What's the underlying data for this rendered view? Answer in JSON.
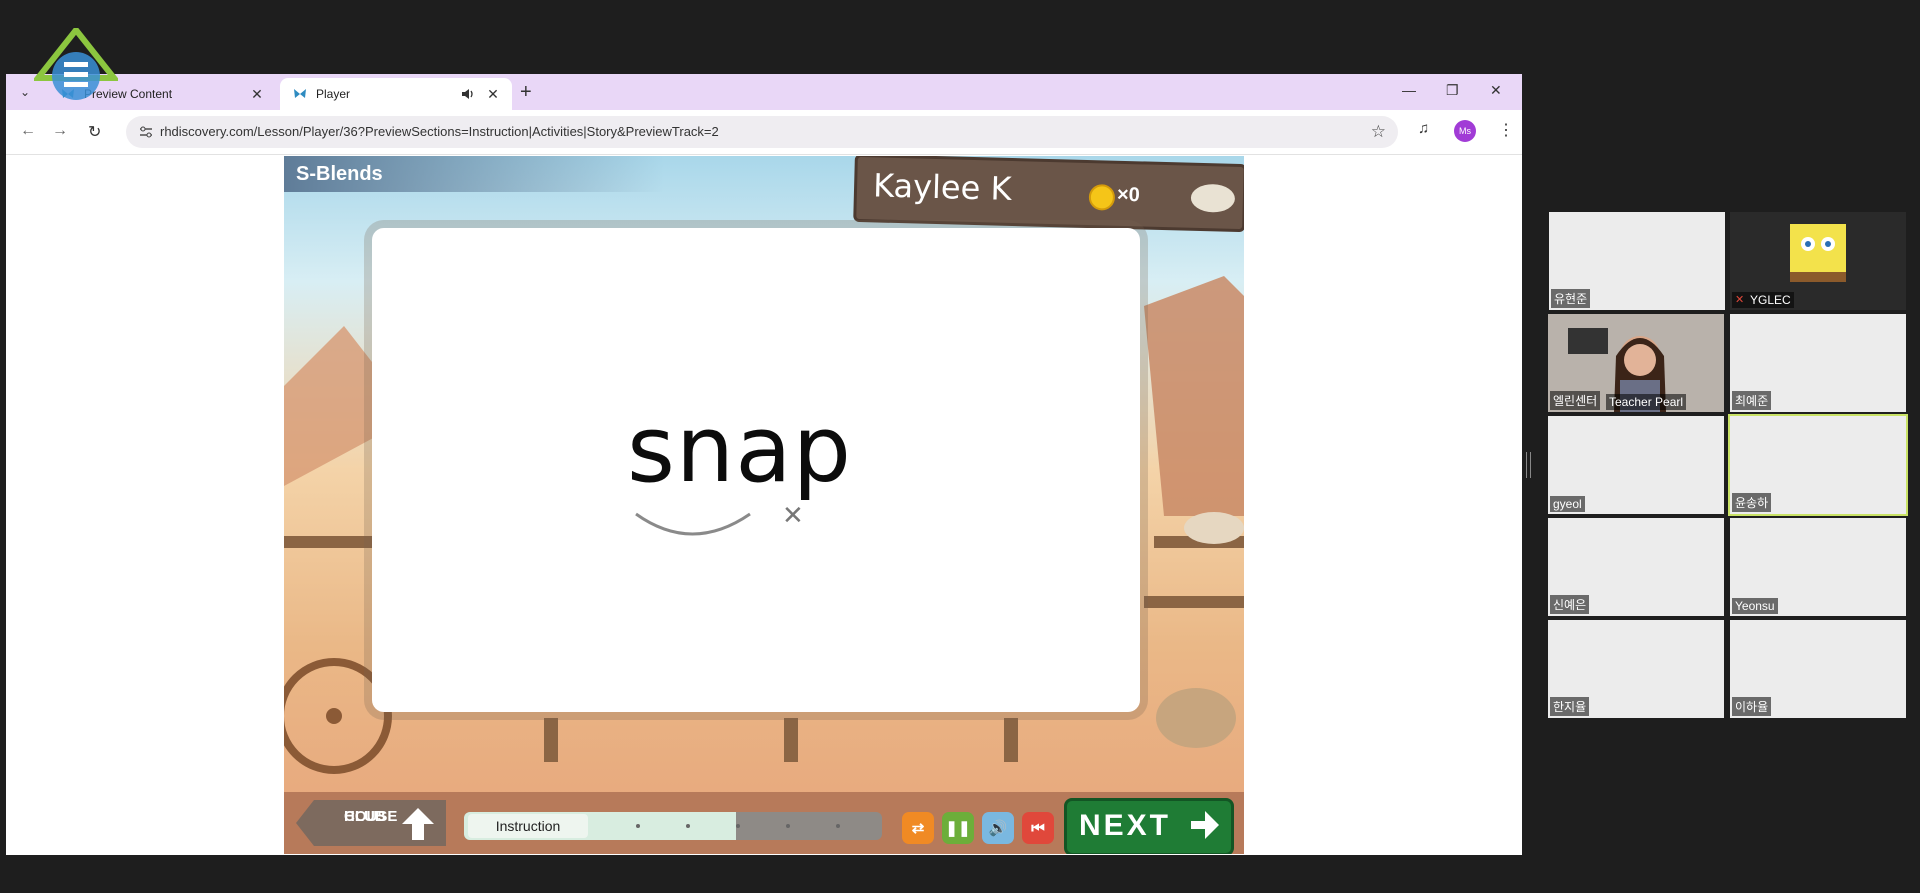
{
  "browser": {
    "tabs": [
      {
        "title": "Preview Content",
        "active": false
      },
      {
        "title": "Player",
        "active": true
      }
    ],
    "url": "rhdiscovery.com/Lesson/Player/36?PreviewSections=Instruction|Activities|Story&PreviewTrack=2",
    "profile_initials": "Ms",
    "accent": "#e9d7f7"
  },
  "game": {
    "section_title": "S-Blends",
    "student_name": "Kaylee K",
    "coin_count": "×0",
    "word": "snap",
    "clubhouse_label_1": "CLUB",
    "clubhouse_label_2": "HOUSE",
    "progress_label": "Instruction",
    "progress_fraction": 0.65,
    "next_label": "NEXT",
    "controls": [
      "swap-icon",
      "pause-icon",
      "volume-icon",
      "rewind-icon"
    ]
  },
  "meeting": {
    "participants": [
      {
        "name": "유현준"
      },
      {
        "name": "YGLEC",
        "muted": true
      },
      {
        "name": "엘린센터"
      },
      {
        "name": "Teacher Pearl"
      },
      {
        "name": "최예준"
      },
      {
        "name": "gyeol"
      },
      {
        "name": "윤송하",
        "speaking": true
      },
      {
        "name": "신예은"
      },
      {
        "name": "Yeonsu"
      },
      {
        "name": "한지율"
      },
      {
        "name": "이하율"
      }
    ]
  }
}
